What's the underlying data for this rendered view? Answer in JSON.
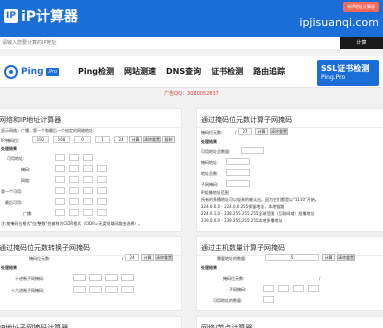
{
  "header": {
    "logo_text": "iP计算器",
    "logo_mark": "IP",
    "domain": "ipjisuanqi.com",
    "top_badge": "新IP地址计算器"
  },
  "search": {
    "placeholder": "请输入您要计算的IP地址",
    "button": "计算"
  },
  "banner": {
    "brand": "Ping",
    "brand_badge": ".Pro",
    "nav": [
      "Ping检测",
      "网站测速",
      "DNS查询",
      "证书检测",
      "路由追踪"
    ],
    "ssl_title": "SSL证书检测",
    "ssl_sub": "Ping.Pro"
  },
  "qq_note": "广告QQ：3080052837",
  "card1": {
    "title": "网络和IP地址计算器",
    "desc": "显示网络，广播，第一个和最后一个给定的网络地址:",
    "ip_label": "IP/掩码位:",
    "ip": [
      "192",
      "168",
      "0",
      "1"
    ],
    "mask": "24",
    "btn_calc": "计算",
    "btn_clear": "清除重置",
    "btn_copy": "复制",
    "result_head": "处理结果",
    "rows": [
      "可用地址:",
      "掩码:",
      "网络:",
      "第一个可用:",
      "最后可用:",
      "广播:"
    ],
    "note": "注:按掩码位格式\"位/整数\"也被称为CIDR格式（CIDR=无类别域间路由选择）。"
  },
  "card2": {
    "title": "通过掩码位元数计算子网掩码",
    "label": "掩码位元数:",
    "bits": "27",
    "btn_calc": "计算",
    "btn_clear": "清除重置",
    "result_head": "处理结果",
    "rows": [
      "可用地址总数量:",
      "掩码地址:",
      "地址总数:",
      "子网掩码:"
    ],
    "ip_ranges_title": "IP组播地址范围",
    "lines": [
      "所有的多播地址可以轻易的被认出，因为它们都是以\"1110\"开始。",
      "224.0.0.0 - 224.0.0.255保留地址，本地链路",
      "224.0.1.0 - 238.255.255.255全球范围（互联网域）组播地址",
      "239.0.0.0 - 239.255.255.255本地多播地址"
    ]
  },
  "card3": {
    "title": "通过掩码位元数转换子网掩码",
    "label": "掩码位元数:",
    "bits": "24",
    "btn_calc": "计算",
    "btn_clear": "清除重置",
    "result_head": "处理结果",
    "rows": [
      "十进制子网掩码:",
      "十六进制子网掩码:"
    ]
  },
  "card4": {
    "title": "通过主机数量计算子网掩码",
    "label": "需要地址的数量:",
    "count": "5",
    "btn_calc": "计算",
    "btn_clear": "清除重置",
    "result_head": "处理结果",
    "rows": [
      "掩码位元数:",
      "子网掩码:",
      "可用地址的数量:"
    ],
    "slash": "/"
  },
  "card5": {
    "title": "IP地址子网掩码计算器"
  },
  "card6": {
    "title": "网络/节点计算器"
  }
}
